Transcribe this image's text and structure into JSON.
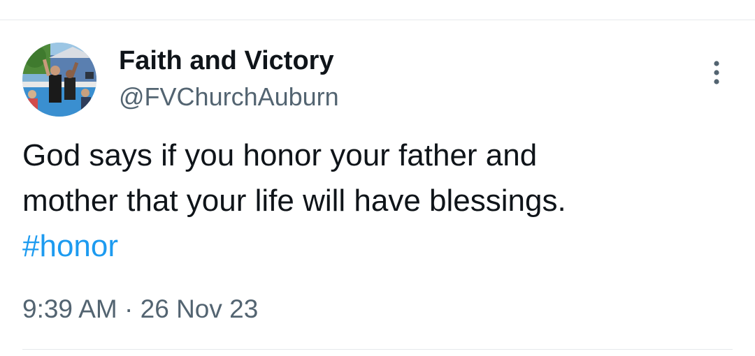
{
  "author": {
    "display_name": "Faith and Victory",
    "handle": "@FVChurchAuburn",
    "avatar_icon": "church-group-photo"
  },
  "tweet": {
    "line1": "God says if you honor your father and",
    "line2": "mother that your life will have blessings.",
    "hashtag": "#honor"
  },
  "meta": {
    "time": "9:39 AM",
    "separator": "·",
    "date": "26 Nov 23"
  },
  "icons": {
    "more": "more-vertical-icon"
  },
  "colors": {
    "text": "#0f1419",
    "secondary": "#536471",
    "link": "#1d9bf0",
    "divider": "#e6e9ec"
  }
}
